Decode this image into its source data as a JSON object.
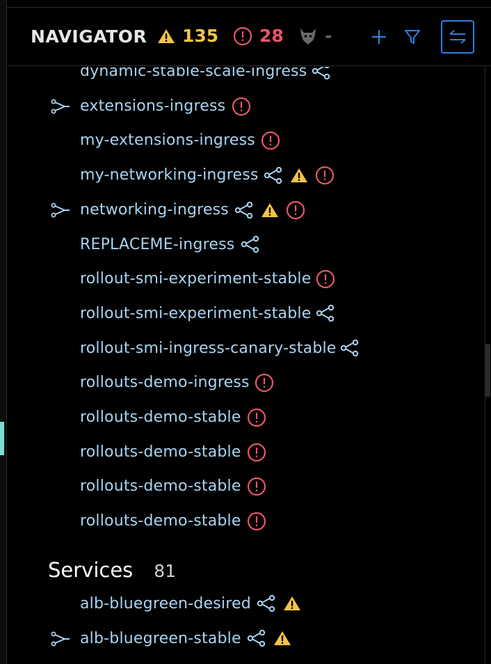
{
  "header": {
    "title": "NAVIGATOR",
    "warning_count": "135",
    "error_count": "28",
    "policy_count": "-",
    "add_icon": "plus-icon",
    "filter_icon": "filter-icon",
    "collapse_icon": "collapse-icon"
  },
  "colors": {
    "background": "#000000",
    "item_text": "#a9d3f0",
    "warning": "#f5c443",
    "error": "#e8566b",
    "accent": "#2f7fe0"
  },
  "ingresses": [
    {
      "label": "dynamic-stable-scale-ingress",
      "expandable": false,
      "icons": [
        "relations-icon"
      ]
    },
    {
      "label": "extensions-ingress",
      "expandable": true,
      "icons": [
        "error-icon"
      ]
    },
    {
      "label": "my-extensions-ingress",
      "expandable": false,
      "icons": [
        "error-icon"
      ]
    },
    {
      "label": "my-networking-ingress",
      "expandable": false,
      "icons": [
        "relations-icon",
        "warning-icon",
        "error-icon"
      ]
    },
    {
      "label": "networking-ingress",
      "expandable": true,
      "icons": [
        "relations-icon",
        "warning-icon",
        "error-icon"
      ]
    },
    {
      "label": "REPLACEME-ingress",
      "expandable": false,
      "icons": [
        "relations-icon"
      ]
    },
    {
      "label": "rollout-smi-experiment-stable",
      "expandable": false,
      "icons": [
        "error-icon"
      ]
    },
    {
      "label": "rollout-smi-experiment-stable",
      "expandable": false,
      "icons": [
        "relations-icon"
      ]
    },
    {
      "label": "rollout-smi-ingress-canary-stable",
      "expandable": false,
      "icons": [
        "relations-icon"
      ]
    },
    {
      "label": "rollouts-demo-ingress",
      "expandable": false,
      "icons": [
        "error-icon"
      ]
    },
    {
      "label": "rollouts-demo-stable",
      "expandable": false,
      "icons": [
        "error-icon"
      ]
    },
    {
      "label": "rollouts-demo-stable",
      "expandable": false,
      "icons": [
        "error-icon"
      ]
    },
    {
      "label": "rollouts-demo-stable",
      "expandable": false,
      "icons": [
        "error-icon"
      ]
    },
    {
      "label": "rollouts-demo-stable",
      "expandable": false,
      "icons": [
        "error-icon"
      ]
    }
  ],
  "services_section": {
    "title": "Services",
    "count": "81"
  },
  "services": [
    {
      "label": "alb-bluegreen-desired",
      "expandable": false,
      "icons": [
        "relations-icon",
        "warning-icon"
      ]
    },
    {
      "label": "alb-bluegreen-stable",
      "expandable": true,
      "icons": [
        "relations-icon",
        "warning-icon"
      ]
    }
  ]
}
